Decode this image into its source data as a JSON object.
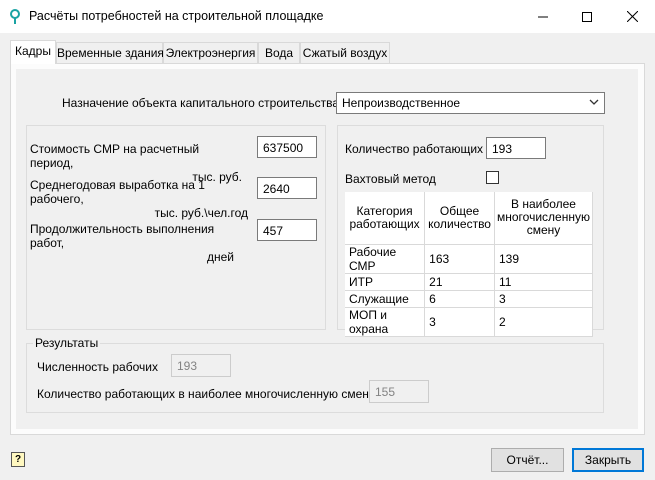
{
  "window": {
    "title": "Расчёты потребностей на строительной площадке",
    "icon": "map-pin-icon"
  },
  "tabs": [
    {
      "label": "Кадры",
      "active": true
    },
    {
      "label": "Временные здания",
      "active": false
    },
    {
      "label": "Электроэнергия",
      "active": false
    },
    {
      "label": "Вода",
      "active": false
    },
    {
      "label": "Сжатый воздух",
      "active": false
    }
  ],
  "purpose": {
    "label": "Назначение объекта капитального строительства",
    "value": "Непроизводственное"
  },
  "left": {
    "cost": {
      "label_line1": "Стоимость СМР на расчетный период,",
      "label_line2": "тыс. руб.",
      "value": "637500"
    },
    "output": {
      "label_line1": "Среднегодовая выработка на 1 рабочего,",
      "label_line2": "тыс. руб.\\чел.год",
      "value": "2640"
    },
    "duration": {
      "label_line1": "Продолжительность выполнения работ,",
      "label_line2": "дней",
      "value": "457"
    }
  },
  "right": {
    "workers": {
      "label": "Количество работающих",
      "value": "193"
    },
    "rotation": {
      "label": "Вахтовый метод",
      "checked": false
    },
    "table": {
      "headers": [
        "Категория работающих",
        "Общее количество",
        "В наиболее многочисленную смену"
      ],
      "rows": [
        [
          "Рабочие СМР",
          "163",
          "139"
        ],
        [
          "ИТР",
          "21",
          "11"
        ],
        [
          "Служащие",
          "6",
          "3"
        ],
        [
          "МОП и охрана",
          "3",
          "2"
        ]
      ]
    }
  },
  "results": {
    "title": "Результаты",
    "workers_count": {
      "label": "Численность рабочих",
      "value": "193"
    },
    "max_shift": {
      "label": "Количество работающих в наиболее многочисленную смену",
      "value": "155"
    }
  },
  "buttons": {
    "report": "Отчёт...",
    "close": "Закрыть"
  },
  "colors": {
    "accent": "#0078d7",
    "icon_teal": "#1aa3a3"
  }
}
